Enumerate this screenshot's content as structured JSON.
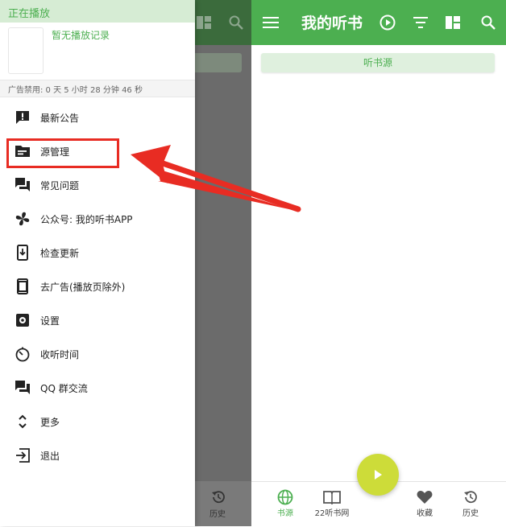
{
  "appbar": {
    "title": "我的听书"
  },
  "main": {
    "source_chip": "听书源"
  },
  "bottom_nav": {
    "items": [
      {
        "label": "书源"
      },
      {
        "label": "22听书网"
      },
      {
        "label": "收藏"
      },
      {
        "label": "历史"
      }
    ]
  },
  "dim_nav": {
    "label": "历史"
  },
  "drawer": {
    "now_playing": "正在播放",
    "no_record": "暂无播放记录",
    "ad_status": "广告禁用: 0 天 5 小时 28 分钟 46 秒",
    "menu": [
      {
        "label": "最新公告",
        "icon": "announcement-icon"
      },
      {
        "label": "源管理",
        "icon": "source-folder-icon"
      },
      {
        "label": "常见问题",
        "icon": "faq-chat-icon"
      },
      {
        "label": "公众号: 我的听书APP",
        "icon": "pinwheel-icon"
      },
      {
        "label": "检查更新",
        "icon": "update-phone-icon"
      },
      {
        "label": "去广告(播放页除外)",
        "icon": "phone-icon"
      },
      {
        "label": "设置",
        "icon": "settings-icon"
      },
      {
        "label": "收听时间",
        "icon": "timer-icon"
      },
      {
        "label": "QQ 群交流",
        "icon": "chat-icon"
      },
      {
        "label": "更多",
        "icon": "expand-icon"
      },
      {
        "label": "退出",
        "icon": "exit-icon"
      }
    ]
  },
  "colors": {
    "primary": "#4CAF50",
    "fab": "#cddc39",
    "annotation": "#e82c23"
  }
}
